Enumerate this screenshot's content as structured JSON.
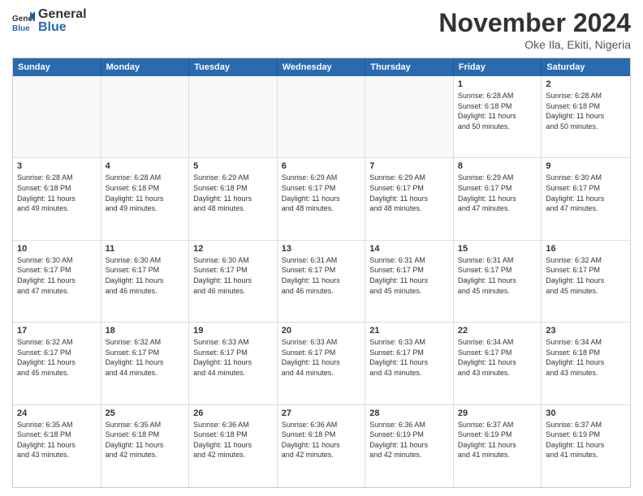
{
  "logo": {
    "general": "General",
    "blue": "Blue"
  },
  "title": "November 2024",
  "subtitle": "Oke Ila, Ekiti, Nigeria",
  "header_days": [
    "Sunday",
    "Monday",
    "Tuesday",
    "Wednesday",
    "Thursday",
    "Friday",
    "Saturday"
  ],
  "weeks": [
    [
      {
        "day": "",
        "info": ""
      },
      {
        "day": "",
        "info": ""
      },
      {
        "day": "",
        "info": ""
      },
      {
        "day": "",
        "info": ""
      },
      {
        "day": "",
        "info": ""
      },
      {
        "day": "1",
        "info": "Sunrise: 6:28 AM\nSunset: 6:18 PM\nDaylight: 11 hours\nand 50 minutes."
      },
      {
        "day": "2",
        "info": "Sunrise: 6:28 AM\nSunset: 6:18 PM\nDaylight: 11 hours\nand 50 minutes."
      }
    ],
    [
      {
        "day": "3",
        "info": "Sunrise: 6:28 AM\nSunset: 6:18 PM\nDaylight: 11 hours\nand 49 minutes."
      },
      {
        "day": "4",
        "info": "Sunrise: 6:28 AM\nSunset: 6:18 PM\nDaylight: 11 hours\nand 49 minutes."
      },
      {
        "day": "5",
        "info": "Sunrise: 6:29 AM\nSunset: 6:18 PM\nDaylight: 11 hours\nand 48 minutes."
      },
      {
        "day": "6",
        "info": "Sunrise: 6:29 AM\nSunset: 6:17 PM\nDaylight: 11 hours\nand 48 minutes."
      },
      {
        "day": "7",
        "info": "Sunrise: 6:29 AM\nSunset: 6:17 PM\nDaylight: 11 hours\nand 48 minutes."
      },
      {
        "day": "8",
        "info": "Sunrise: 6:29 AM\nSunset: 6:17 PM\nDaylight: 11 hours\nand 47 minutes."
      },
      {
        "day": "9",
        "info": "Sunrise: 6:30 AM\nSunset: 6:17 PM\nDaylight: 11 hours\nand 47 minutes."
      }
    ],
    [
      {
        "day": "10",
        "info": "Sunrise: 6:30 AM\nSunset: 6:17 PM\nDaylight: 11 hours\nand 47 minutes."
      },
      {
        "day": "11",
        "info": "Sunrise: 6:30 AM\nSunset: 6:17 PM\nDaylight: 11 hours\nand 46 minutes."
      },
      {
        "day": "12",
        "info": "Sunrise: 6:30 AM\nSunset: 6:17 PM\nDaylight: 11 hours\nand 46 minutes."
      },
      {
        "day": "13",
        "info": "Sunrise: 6:31 AM\nSunset: 6:17 PM\nDaylight: 11 hours\nand 46 minutes."
      },
      {
        "day": "14",
        "info": "Sunrise: 6:31 AM\nSunset: 6:17 PM\nDaylight: 11 hours\nand 45 minutes."
      },
      {
        "day": "15",
        "info": "Sunrise: 6:31 AM\nSunset: 6:17 PM\nDaylight: 11 hours\nand 45 minutes."
      },
      {
        "day": "16",
        "info": "Sunrise: 6:32 AM\nSunset: 6:17 PM\nDaylight: 11 hours\nand 45 minutes."
      }
    ],
    [
      {
        "day": "17",
        "info": "Sunrise: 6:32 AM\nSunset: 6:17 PM\nDaylight: 11 hours\nand 45 minutes."
      },
      {
        "day": "18",
        "info": "Sunrise: 6:32 AM\nSunset: 6:17 PM\nDaylight: 11 hours\nand 44 minutes."
      },
      {
        "day": "19",
        "info": "Sunrise: 6:33 AM\nSunset: 6:17 PM\nDaylight: 11 hours\nand 44 minutes."
      },
      {
        "day": "20",
        "info": "Sunrise: 6:33 AM\nSunset: 6:17 PM\nDaylight: 11 hours\nand 44 minutes."
      },
      {
        "day": "21",
        "info": "Sunrise: 6:33 AM\nSunset: 6:17 PM\nDaylight: 11 hours\nand 43 minutes."
      },
      {
        "day": "22",
        "info": "Sunrise: 6:34 AM\nSunset: 6:17 PM\nDaylight: 11 hours\nand 43 minutes."
      },
      {
        "day": "23",
        "info": "Sunrise: 6:34 AM\nSunset: 6:18 PM\nDaylight: 11 hours\nand 43 minutes."
      }
    ],
    [
      {
        "day": "24",
        "info": "Sunrise: 6:35 AM\nSunset: 6:18 PM\nDaylight: 11 hours\nand 43 minutes."
      },
      {
        "day": "25",
        "info": "Sunrise: 6:35 AM\nSunset: 6:18 PM\nDaylight: 11 hours\nand 42 minutes."
      },
      {
        "day": "26",
        "info": "Sunrise: 6:36 AM\nSunset: 6:18 PM\nDaylight: 11 hours\nand 42 minutes."
      },
      {
        "day": "27",
        "info": "Sunrise: 6:36 AM\nSunset: 6:18 PM\nDaylight: 11 hours\nand 42 minutes."
      },
      {
        "day": "28",
        "info": "Sunrise: 6:36 AM\nSunset: 6:19 PM\nDaylight: 11 hours\nand 42 minutes."
      },
      {
        "day": "29",
        "info": "Sunrise: 6:37 AM\nSunset: 6:19 PM\nDaylight: 11 hours\nand 41 minutes."
      },
      {
        "day": "30",
        "info": "Sunrise: 6:37 AM\nSunset: 6:19 PM\nDaylight: 11 hours\nand 41 minutes."
      }
    ]
  ]
}
